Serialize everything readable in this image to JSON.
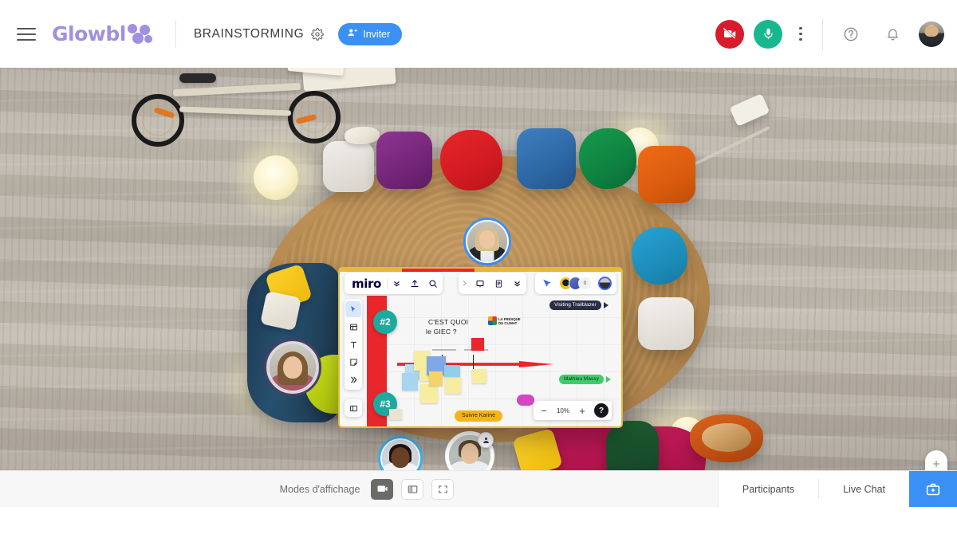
{
  "header": {
    "menu_icon": "hamburger-icon",
    "brand": "Glowbl",
    "room_title": "BRAINSTORMING",
    "settings_icon": "gear-icon",
    "invite_label": "Inviter",
    "invite_icon": "add-person-icon",
    "camera_icon": "camera-off-icon",
    "camera_state": "off",
    "mic_icon": "microphone-icon",
    "mic_state": "on",
    "more_icon": "kebab-menu-icon",
    "help_icon": "question-circle-icon",
    "notifications_icon": "bell-icon",
    "avatar_name": "user-avatar"
  },
  "colors": {
    "brand_purple": "#a18fe0",
    "accent_blue": "#3b90f5",
    "camera_red": "#d91c2b",
    "mic_green": "#17b890",
    "board_border": "#e4b93c",
    "miro_red": "#e8262b",
    "teal_bubble": "#1fa8a0"
  },
  "board": {
    "app_name": "miro",
    "toolbar": {
      "expand_icon": "chevron-double-down-icon",
      "upload_icon": "upload-icon",
      "search_icon": "search-icon",
      "collapse_icon": "chevron-right-icon",
      "frame_icon": "frame-icon",
      "notes_icon": "document-icon",
      "more_icon": "chevron-double-down-icon",
      "present_icon": "cursor-share-icon",
      "collaborator_count": "0"
    },
    "left_tools": [
      {
        "name": "select-tool",
        "icon": "cursor-arrow-icon",
        "selected": true
      },
      {
        "name": "template-tool",
        "icon": "template-icon",
        "selected": false
      },
      {
        "name": "text-tool",
        "icon": "text-t-icon",
        "selected": false
      },
      {
        "name": "sticky-note-tool",
        "icon": "sticky-note-icon",
        "selected": false
      },
      {
        "name": "more-tools",
        "icon": "chevron-double-right-icon",
        "selected": false
      }
    ],
    "panel_tool": {
      "name": "panel-toggle",
      "icon": "panel-layout-icon"
    },
    "markers": [
      "#2",
      "#3"
    ],
    "canvas_title_line1": "C'EST QUOI",
    "canvas_title_line2": "le GIEC ?",
    "fresque_line1": "LA FRESQUE",
    "fresque_line2": "DU CLIMAT",
    "cursors": [
      {
        "label": "Visiting Trailblazer",
        "bg": "#2a2e45",
        "fg": "#ffffff"
      },
      {
        "label": "Mathieu Massy",
        "bg": "#3fcc6a",
        "fg": "#10331b"
      },
      {
        "label": "Suivre Karine",
        "bg": "#f5b514",
        "fg": "#3a2a00"
      }
    ],
    "zoom": {
      "minus_icon": "minus-icon",
      "value": "10%",
      "plus_icon": "plus-icon",
      "help_icon": "question-mark-icon",
      "help_label": "?"
    }
  },
  "stage": {
    "zoom_controls": {
      "zoom_in_icon": "plus-icon",
      "zoom_out_icon": "minus-icon",
      "recenter_icon": "recenter-target-icon"
    },
    "participants": [
      {
        "name": "participant-top-center",
        "seat": "red-beanbag",
        "ring": "#3b90f5"
      },
      {
        "name": "participant-left-sofa",
        "seat": "blue-sofa",
        "ring": "#4a3f63"
      },
      {
        "name": "participant-bottom-left",
        "seat": "magenta-pouf",
        "ring": "#3bb0f0"
      },
      {
        "name": "participant-bottom-center",
        "seat": "orange-beanbag",
        "ring": "#ffffff",
        "badge_icon": "presenter-badge-icon"
      }
    ]
  },
  "footer": {
    "display_modes_label": "Modes d'affichage",
    "modes": [
      {
        "name": "mode-stage-view",
        "icon": "stage-view-icon",
        "active": true
      },
      {
        "name": "mode-split-view",
        "icon": "split-view-icon",
        "active": false
      },
      {
        "name": "mode-fullscreen",
        "icon": "fullscreen-icon",
        "active": false
      }
    ],
    "participants_label": "Participants",
    "live_chat_label": "Live Chat",
    "toolkit_icon": "briefcase-icon"
  }
}
